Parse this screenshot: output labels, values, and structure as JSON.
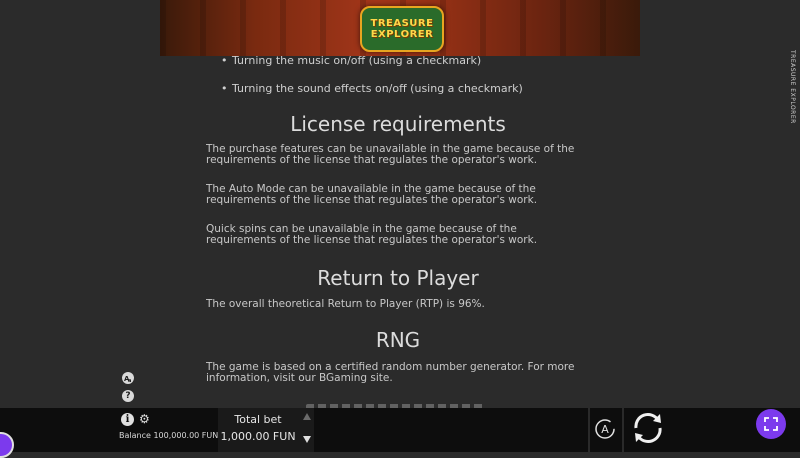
{
  "header": {
    "logo_line1": "TREASURE",
    "logo_line2": "EXPLORER",
    "side_title": "TREASURE EXPLORER"
  },
  "rules": {
    "bullets": [
      "Turning the music on/off (using a checkmark)",
      "Turning the sound effects on/off (using a checkmark)"
    ],
    "license_heading": "License requirements",
    "license_paragraphs": [
      "The purchase features can be unavailable in the game because of the requirements of the license that regulates the operator's work.",
      "The Auto Mode can be unavailable in the game because of the requirements of the license that regulates the operator's work.",
      "Quick spins can be unavailable in the game because of the requirements of the license that regulates the operator's work."
    ],
    "rtp_heading": "Return to Player",
    "rtp_text": "The overall theoretical Return to Player (RTP) is 96%.",
    "rng_heading": "RNG",
    "rng_text": "The game is based on a certified random number generator. For more information, visit our BGaming site."
  },
  "bottom_bar": {
    "balance_text": "Balance 100,000.00 FUN",
    "total_bet_label": "Total bet",
    "total_bet_value": "1,000.00 FUN",
    "auto_label": "A"
  },
  "icons": {
    "language": "translate-icon",
    "help": "question-icon",
    "info": "info-icon",
    "settings": "gear-icon",
    "spin": "spin-icon",
    "fullscreen": "fullscreen-icon"
  },
  "colors": {
    "background": "#2b2b2b",
    "bar": "#0d0d0d",
    "accent": "#7c3aed"
  }
}
